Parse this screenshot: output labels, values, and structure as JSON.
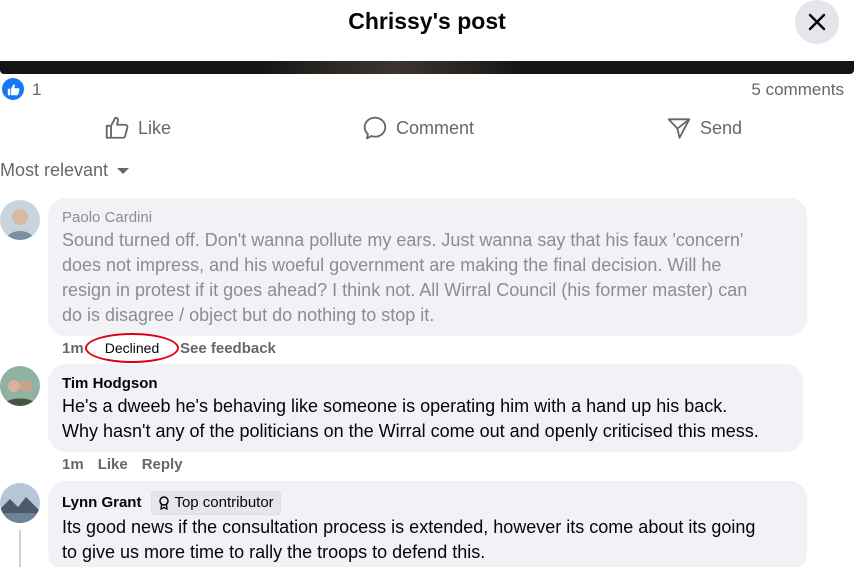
{
  "header": {
    "title": "Chrissy's post"
  },
  "reactions": {
    "like_count": "1",
    "comments_label": "5 comments"
  },
  "actions": {
    "like": "Like",
    "comment": "Comment",
    "send": "Send"
  },
  "sort": {
    "label": "Most relevant"
  },
  "comments": [
    {
      "author": "Paolo Cardini",
      "lines": [
        "Sound turned off. Don't wanna pollute my ears. Just wanna say that his faux 'concern'",
        "does not impress, and his woeful government are making the final decision. Will he",
        "resign in protest if it goes ahead? I think not. All Wirral Council (his former master) can",
        "do is disagree / object but do nothing to stop it."
      ],
      "time": "1m",
      "status": "Declined",
      "feedback": "See feedback"
    },
    {
      "author": "Tim Hodgson",
      "lines": [
        "He's a dweeb he's behaving like someone is operating him with a hand up his back.",
        "Why hasn't any of the politicians on the Wirral come out and openly criticised this mess."
      ],
      "time": "1m",
      "like": "Like",
      "reply": "Reply"
    },
    {
      "author": "Lynn Grant",
      "badge": "Top contributor",
      "lines": [
        "Its good news if the consultation process is extended, however its come about its going",
        "to give us more time to rally the troops to defend this."
      ]
    }
  ],
  "colors": {
    "brand_blue": "#1877f2",
    "bubble": "#f0f2f5",
    "muted_text": "#65676b",
    "declined_outline": "#e0000f"
  },
  "icons": {
    "close": "close-icon",
    "like": "thumbs-up-icon",
    "comment": "comment-bubble-icon",
    "send": "send-icon",
    "sort": "caret-down-icon",
    "badge": "award-ribbon-icon"
  }
}
